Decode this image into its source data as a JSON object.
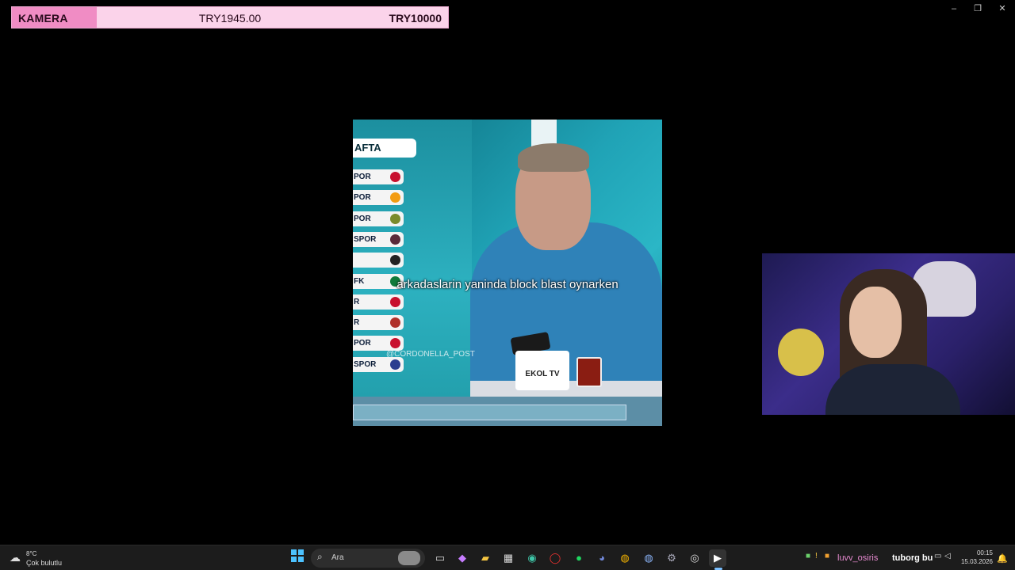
{
  "goal": {
    "label": "KAMERA",
    "current": "TRY1945.00",
    "target": "TRY10000",
    "progress_fraction": 0.1945,
    "colors": {
      "fill": "#f08cc4",
      "bg": "#fbd3ea"
    }
  },
  "window_controls": {
    "minimize": "–",
    "maximize": "❐",
    "close": "✕"
  },
  "video": {
    "week_label": "AFTA",
    "teams": [
      "POR",
      "POR",
      "POR",
      "SPOR",
      "",
      "FK",
      "R",
      "R",
      "POR",
      "SPOR"
    ],
    "crest_colors": [
      "#c8102e",
      "#f39c12",
      "#7a8b2c",
      "#5a2a3a",
      "#222",
      "#117a3a",
      "#c8102e",
      "#b0302a",
      "#c8102e",
      "#2c3e8f"
    ],
    "caption": "arkadaslarin yaninda block blast oynarken",
    "watermark": "@CORDONELLA_POST",
    "mug_text": "EKOL TV"
  },
  "taskbar": {
    "weather": {
      "temp": "8°C",
      "condition": "Çok bulutlu",
      "icon": "cloud-icon"
    },
    "search_placeholder": "Ara",
    "apps": [
      "windows-start-icon",
      "task-view-icon",
      "copilot-icon",
      "file-explorer-icon",
      "store-icon",
      "edge-icon",
      "opera-icon",
      "spotify-icon",
      "discord-icon",
      "chrome-icon",
      "chrome-dev-icon",
      "settings-icon",
      "obs-icon",
      "media-player-icon"
    ],
    "tray": {
      "chat_user": "luvv_osiris",
      "chat_message": "tuborg bu",
      "time": "00:15",
      "date": "15.03.2026"
    }
  }
}
